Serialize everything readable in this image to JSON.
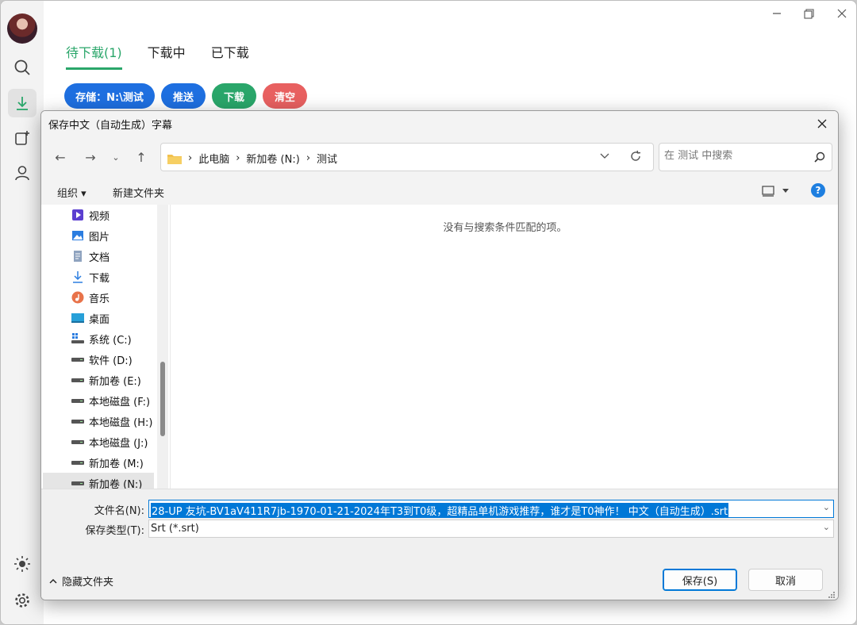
{
  "app": {
    "tabs": [
      {
        "label": "待下载(1)",
        "active": true
      },
      {
        "label": "下载中",
        "active": false
      },
      {
        "label": "已下载",
        "active": false
      }
    ],
    "actions": {
      "storage": "存储：N:\\测试",
      "push": "推送",
      "download": "下载",
      "clear": "清空"
    },
    "colors": {
      "accent": "#2aa66a",
      "blue": "#1e6fe0",
      "red": "#e86060"
    }
  },
  "dialog": {
    "title": "保存中文（自动生成）字幕",
    "breadcrumb": [
      "此电脑",
      "新加卷 (N:)",
      "测试"
    ],
    "search_placeholder": "在 测试 中搜索",
    "organize": "组织 ▾",
    "new_folder": "新建文件夹",
    "tree": [
      {
        "label": "视频",
        "icon": "video-icon"
      },
      {
        "label": "图片",
        "icon": "pictures-icon"
      },
      {
        "label": "文档",
        "icon": "document-icon"
      },
      {
        "label": "下载",
        "icon": "download-icon"
      },
      {
        "label": "音乐",
        "icon": "music-icon"
      },
      {
        "label": "桌面",
        "icon": "desktop-icon"
      },
      {
        "label": "系统 (C:)",
        "icon": "system-drive-icon"
      },
      {
        "label": "软件 (D:)",
        "icon": "drive-icon"
      },
      {
        "label": "新加卷 (E:)",
        "icon": "drive-icon"
      },
      {
        "label": "本地磁盘 (F:)",
        "icon": "drive-icon"
      },
      {
        "label": "本地磁盘 (H:)",
        "icon": "drive-icon"
      },
      {
        "label": "本地磁盘 (J:)",
        "icon": "drive-icon"
      },
      {
        "label": "新加卷 (M:)",
        "icon": "drive-icon"
      },
      {
        "label": "新加卷 (N:)",
        "icon": "drive-icon",
        "selected": true
      }
    ],
    "empty_message": "没有与搜索条件匹配的项。",
    "filename_label": "文件名(N):",
    "filename_value": "28-UP 友坑-BV1aV411R7jb-1970-01-21-2024年T3到T0级，超精品单机游戏推荐，谁才是T0神作！ 中文（自动生成）.srt",
    "filetype_label": "保存类型(T):",
    "filetype_value": "Srt (*.srt)",
    "hide_folders": "隐藏文件夹",
    "save": "保存(S)",
    "cancel": "取消"
  }
}
